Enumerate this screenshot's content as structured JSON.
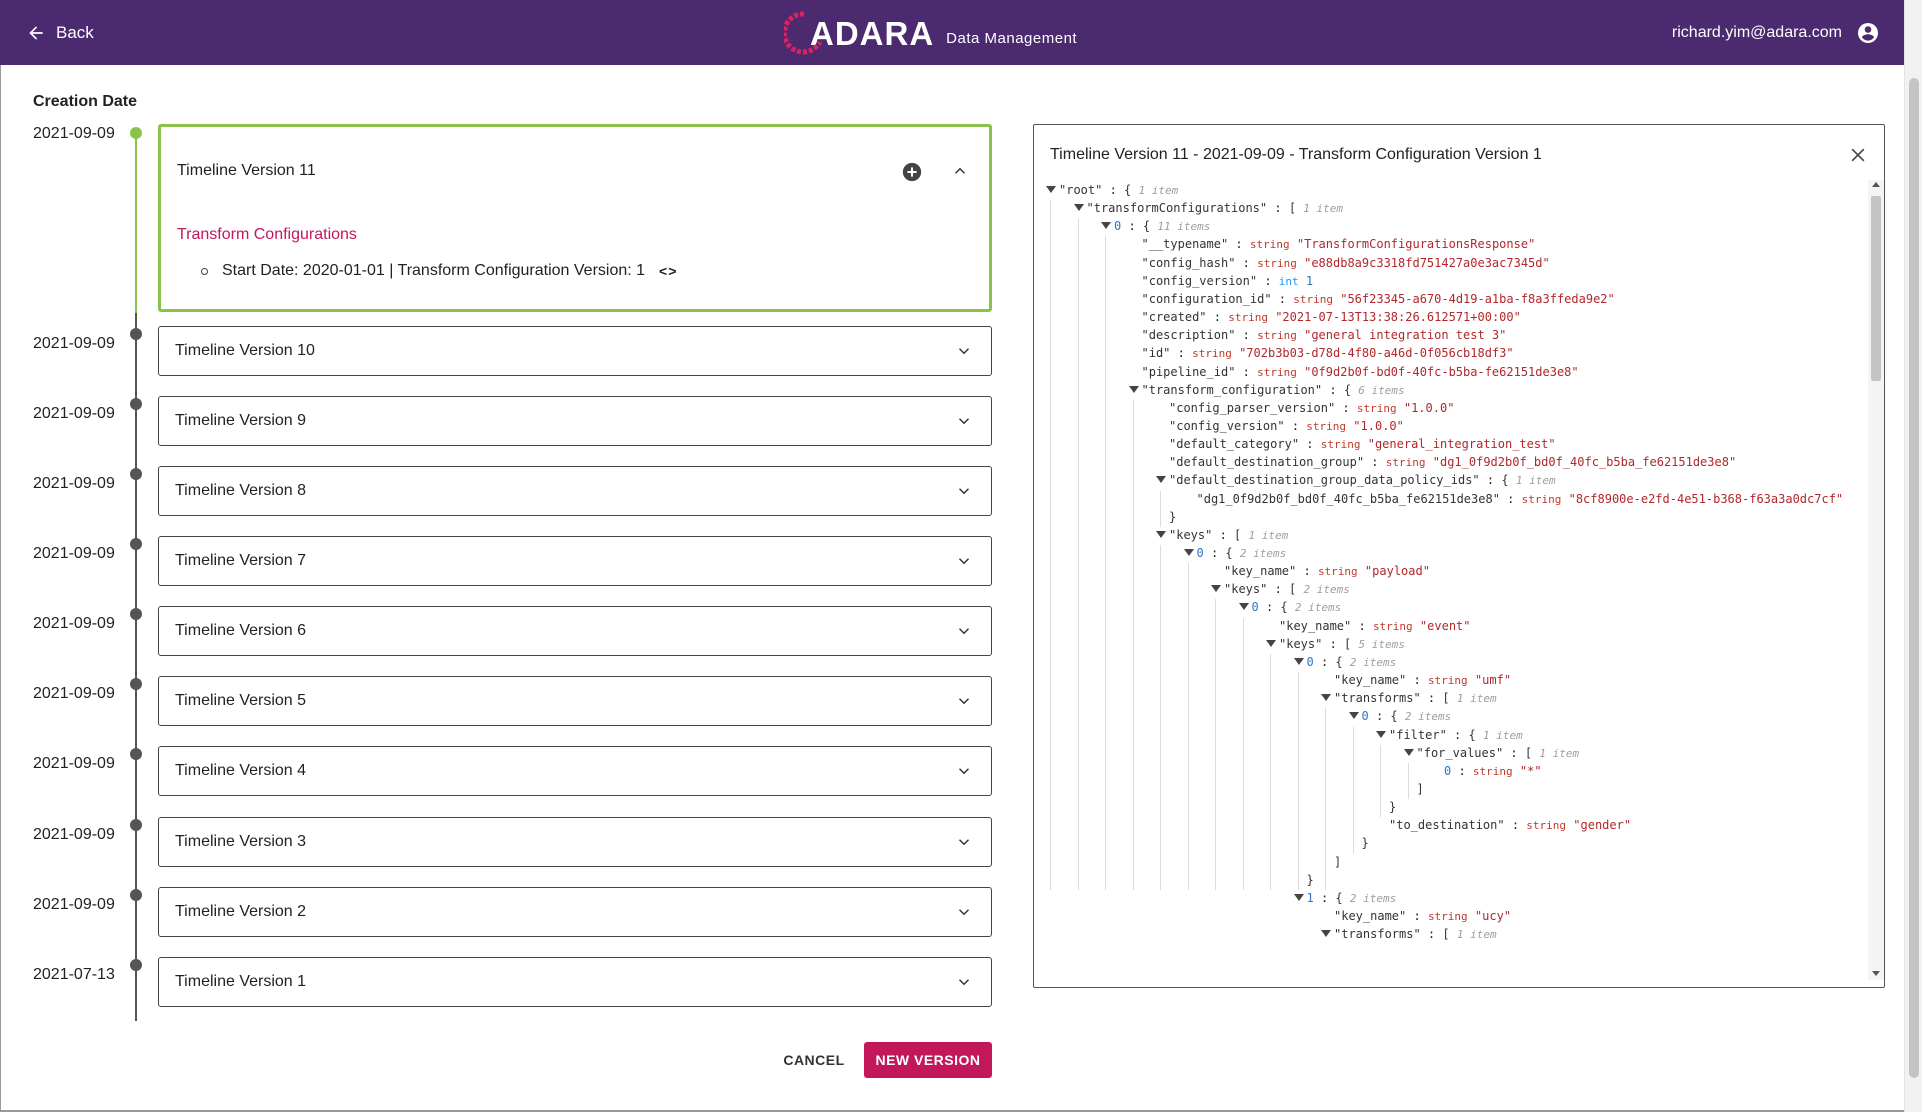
{
  "header": {
    "back_label": "Back",
    "logo_text": "ADARA",
    "logo_subtitle": "Data Management",
    "user_email": "richard.yim@adara.com",
    "brand_color": "#4c2a70"
  },
  "timeline": {
    "column_label": "Creation Date",
    "active_version": {
      "date": "2021-09-09",
      "title": "Timeline Version 11",
      "section_title": "Transform Configurations",
      "item": "Start Date: 2020-01-01 | Transform Configuration Version: 1",
      "code_icon": "<>"
    },
    "versions": [
      {
        "date": "2021-09-09",
        "title": "Timeline Version 10"
      },
      {
        "date": "2021-09-09",
        "title": "Timeline Version 9"
      },
      {
        "date": "2021-09-09",
        "title": "Timeline Version 8"
      },
      {
        "date": "2021-09-09",
        "title": "Timeline Version 7"
      },
      {
        "date": "2021-09-09",
        "title": "Timeline Version 6"
      },
      {
        "date": "2021-09-09",
        "title": "Timeline Version 5"
      },
      {
        "date": "2021-09-09",
        "title": "Timeline Version 4"
      },
      {
        "date": "2021-09-09",
        "title": "Timeline Version 3"
      },
      {
        "date": "2021-09-09",
        "title": "Timeline Version 2"
      },
      {
        "date": "2021-07-13",
        "title": "Timeline Version 1"
      }
    ]
  },
  "actions": {
    "cancel_label": "CANCEL",
    "new_version_label": "NEW VERSION",
    "accent_color": "#c2185b"
  },
  "json_panel": {
    "title": "Timeline Version 11 - 2021-09-09 - Transform Configuration Version 1",
    "rows": [
      {
        "d": 0,
        "key": "\"root\"",
        "open": "{",
        "meta": "1 item"
      },
      {
        "d": 1,
        "key": "\"transformConfigurations\"",
        "open": "[",
        "meta": "1 item"
      },
      {
        "d": 2,
        "key": "0",
        "idx": true,
        "open": "{",
        "meta": "11 items"
      },
      {
        "d": 3,
        "key": "\"__typename\"",
        "type": "string",
        "val": "\"TransformConfigurationsResponse\""
      },
      {
        "d": 3,
        "key": "\"config_hash\"",
        "type": "string",
        "val": "\"e88db8a9c3318fd751427a0e3ac7345d\""
      },
      {
        "d": 3,
        "key": "\"config_version\"",
        "type": "int",
        "val": "1"
      },
      {
        "d": 3,
        "key": "\"configuration_id\"",
        "type": "string",
        "val": "\"56f23345-a670-4d19-a1ba-f8a3ffeda9e2\""
      },
      {
        "d": 3,
        "key": "\"created\"",
        "type": "string",
        "val": "\"2021-07-13T13:38:26.612571+00:00\""
      },
      {
        "d": 3,
        "key": "\"description\"",
        "type": "string",
        "val": "\"general integration test 3\""
      },
      {
        "d": 3,
        "key": "\"id\"",
        "type": "string",
        "val": "\"702b3b03-d78d-4f80-a46d-0f056cb18df3\""
      },
      {
        "d": 3,
        "key": "\"pipeline_id\"",
        "type": "string",
        "val": "\"0f9d2b0f-bd0f-40fc-b5ba-fe62151de3e8\""
      },
      {
        "d": 3,
        "key": "\"transform_configuration\"",
        "open": "{",
        "meta": "6 items"
      },
      {
        "d": 4,
        "key": "\"config_parser_version\"",
        "type": "string",
        "val": "\"1.0.0\""
      },
      {
        "d": 4,
        "key": "\"config_version\"",
        "type": "string",
        "val": "\"1.0.0\""
      },
      {
        "d": 4,
        "key": "\"default_category\"",
        "type": "string",
        "val": "\"general_integration_test\""
      },
      {
        "d": 4,
        "key": "\"default_destination_group\"",
        "type": "string",
        "val": "\"dg1_0f9d2b0f_bd0f_40fc_b5ba_fe62151de3e8\""
      },
      {
        "d": 4,
        "key": "\"default_destination_group_data_policy_ids\"",
        "open": "{",
        "meta": "1 item"
      },
      {
        "d": 5,
        "key": "\"dg1_0f9d2b0f_bd0f_40fc_b5ba_fe62151de3e8\"",
        "type": "string",
        "val": "\"8cf8900e-e2fd-4e51-b368-f63a3a0dc7cf\""
      },
      {
        "d": 4,
        "close": "}"
      },
      {
        "d": 4,
        "key": "\"keys\"",
        "open": "[",
        "meta": "1 item"
      },
      {
        "d": 5,
        "key": "0",
        "idx": true,
        "open": "{",
        "meta": "2 items"
      },
      {
        "d": 6,
        "key": "\"key_name\"",
        "type": "string",
        "val": "\"payload\""
      },
      {
        "d": 6,
        "key": "\"keys\"",
        "open": "[",
        "meta": "2 items"
      },
      {
        "d": 7,
        "key": "0",
        "idx": true,
        "open": "{",
        "meta": "2 items"
      },
      {
        "d": 8,
        "key": "\"key_name\"",
        "type": "string",
        "val": "\"event\""
      },
      {
        "d": 8,
        "key": "\"keys\"",
        "open": "[",
        "meta": "5 items"
      },
      {
        "d": 9,
        "key": "0",
        "idx": true,
        "open": "{",
        "meta": "2 items"
      },
      {
        "d": 10,
        "key": "\"key_name\"",
        "type": "string",
        "val": "\"umf\""
      },
      {
        "d": 10,
        "key": "\"transforms\"",
        "open": "[",
        "meta": "1 item"
      },
      {
        "d": 11,
        "key": "0",
        "idx": true,
        "open": "{",
        "meta": "2 items"
      },
      {
        "d": 12,
        "key": "\"filter\"",
        "open": "{",
        "meta": "1 item"
      },
      {
        "d": 13,
        "key": "\"for_values\"",
        "open": "[",
        "meta": "1 item"
      },
      {
        "d": 14,
        "key": "0",
        "idx": true,
        "type": "string",
        "val": "\"*\""
      },
      {
        "d": 13,
        "close": "]"
      },
      {
        "d": 12,
        "close": "}"
      },
      {
        "d": 12,
        "key": "\"to_destination\"",
        "type": "string",
        "val": "\"gender\""
      },
      {
        "d": 11,
        "close": "}"
      },
      {
        "d": 10,
        "close": "]"
      },
      {
        "d": 9,
        "close": "}"
      },
      {
        "d": 9,
        "key": "1",
        "idx": true,
        "open": "{",
        "meta": "2 items"
      },
      {
        "d": 10,
        "key": "\"key_name\"",
        "type": "string",
        "val": "\"ucy\""
      },
      {
        "d": 10,
        "key": "\"transforms\"",
        "open": "[",
        "meta": "1 item"
      }
    ]
  }
}
